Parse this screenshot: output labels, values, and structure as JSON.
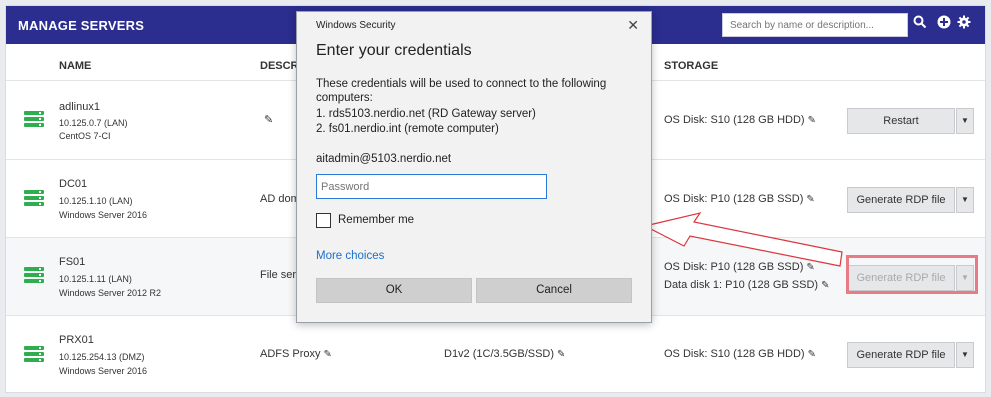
{
  "header": {
    "title": "MANAGE SERVERS",
    "search_placeholder": "Search by name or description...",
    "icons": [
      "search-icon",
      "add-icon",
      "settings-icon"
    ]
  },
  "columns": {
    "name": "NAME",
    "description": "DESCRI",
    "storage": "STORAGE"
  },
  "rows": [
    {
      "name": "adlinux1",
      "ip": "10.125.0.7 (LAN)",
      "os": "CentOS 7-CI",
      "description": "",
      "size": "",
      "storage": [
        "OS Disk: S10 (128 GB HDD)"
      ],
      "action": "Restart"
    },
    {
      "name": "DC01",
      "ip": "10.125.1.10 (LAN)",
      "os": "Windows Server 2016",
      "description": "AD dom",
      "size": "",
      "storage": [
        "OS Disk: P10 (128 GB SSD)"
      ],
      "action": "Generate RDP file"
    },
    {
      "name": "FS01",
      "ip": "10.125.1.11 (LAN)",
      "os": "Windows Server 2012 R2",
      "description": "File ser",
      "size": "",
      "storage": [
        "OS Disk: P10 (128 GB SSD)",
        "Data disk 1: P10 (128 GB SSD)"
      ],
      "action": "Generate RDP file"
    },
    {
      "name": "PRX01",
      "ip": "10.125.254.13 (DMZ)",
      "os": "Windows Server 2016",
      "description": "ADFS Proxy",
      "size": "D1v2 (1C/3.5GB/SSD)",
      "storage": [
        "OS Disk: S10 (128 GB HDD)"
      ],
      "action": "Generate RDP file"
    }
  ],
  "dialog": {
    "caption": "Windows Security",
    "close": "✕",
    "heading": "Enter your credentials",
    "line1": "These credentials will be used to connect to the following",
    "line2": "computers:",
    "line3": "1. rds5103.nerdio.net (RD Gateway server)",
    "line4": "2. fs01.nerdio.int (remote computer)",
    "user": "aitadmin@5103.nerdio.net",
    "password_placeholder": "Password",
    "remember": "Remember me",
    "more": "More choices",
    "ok": "OK",
    "cancel": "Cancel"
  },
  "colors": {
    "header": "#2b2d8f",
    "server_icon": "#2fae4f",
    "highlight": "#e87c84",
    "link": "#1d6fc7"
  }
}
